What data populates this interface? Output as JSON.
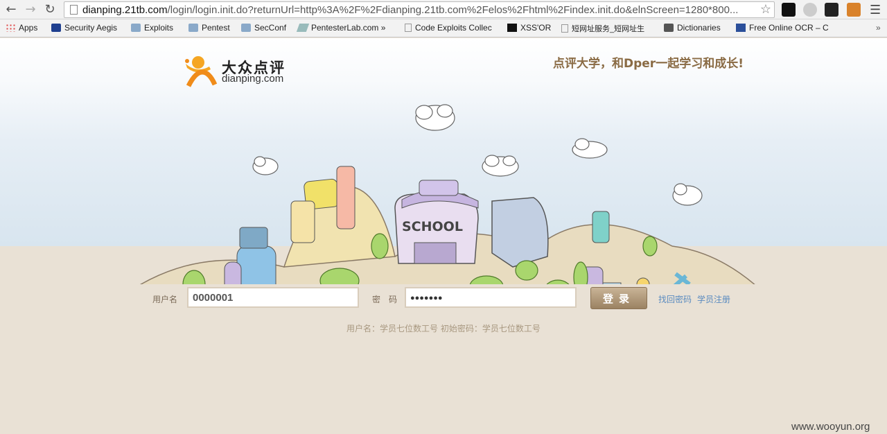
{
  "browser": {
    "url_host": "dianping.21tb.com",
    "url_path": "/login/login.init.do?returnUrl=http%3A%2F%2Fdianping.21tb.com%2Felos%2Fhtml%2Findex.init.do&elnScreen=1280*800...",
    "back_icon": "back-arrow-icon",
    "forward_icon": "forward-arrow-icon",
    "reload_icon": "reload-icon"
  },
  "bookmarks": [
    {
      "label": "Apps",
      "icon": "apps-grid-icon"
    },
    {
      "label": "Security Aegis",
      "icon": "shield-icon"
    },
    {
      "label": "Exploits",
      "icon": "folder-icon"
    },
    {
      "label": "Pentest",
      "icon": "folder-icon"
    },
    {
      "label": "SecConf",
      "icon": "folder-icon"
    },
    {
      "label": "PentesterLab.com »",
      "icon": "pencil-icon"
    },
    {
      "label": "Code Exploits Collec",
      "icon": "page-icon"
    },
    {
      "label": "XSS'OR",
      "icon": "xss-icon"
    },
    {
      "label": "短网址服务_短网址生",
      "icon": "page-icon"
    },
    {
      "label": "Dictionaries",
      "icon": "dictionary-icon"
    },
    {
      "label": "Free Online OCR – C",
      "icon": "ocr-icon"
    }
  ],
  "logo": {
    "cn": "大众点评",
    "en": "dianping.com"
  },
  "slogan": "点评大学，和Dper一起学习和成长!",
  "scene": {
    "school_sign": "SCHOOL"
  },
  "form": {
    "username_label": "用户名",
    "username_value": "0000001",
    "password_label": "密　码",
    "password_value": "●●●●●●●",
    "login_button": "登录",
    "forgot_link": "找回密码",
    "register_link": "学员注册"
  },
  "hint": "用户名：学员七位数工号 初始密码：学员七位数工号",
  "watermark": "www.wooyun.org",
  "colors": {
    "ground": "#e9e1d5",
    "accent": "#8a6b44",
    "link": "#5a8bc0"
  }
}
